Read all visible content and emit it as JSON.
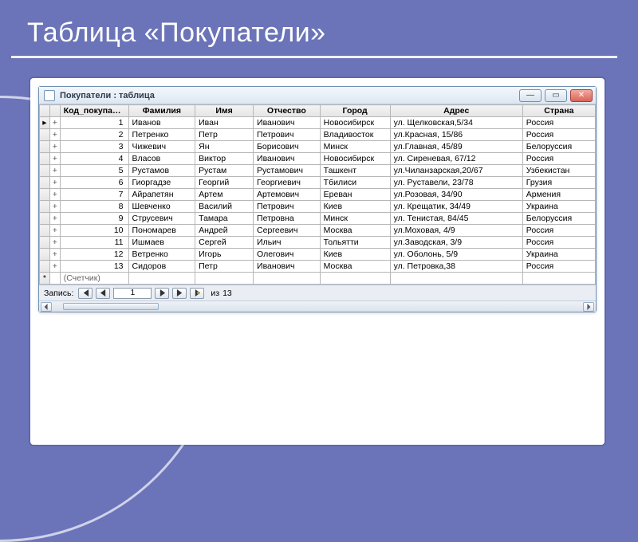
{
  "slide": {
    "title": "Таблица «Покупатели»"
  },
  "window": {
    "title": "Покупатели : таблица",
    "min": "—",
    "restore": "▭",
    "close": "✕"
  },
  "columns": {
    "id": "Код_покупател",
    "surname": "Фамилия",
    "name": "Имя",
    "patronymic": "Отчество",
    "city": "Город",
    "address": "Адрес",
    "country": "Страна"
  },
  "rows": [
    {
      "id": "1",
      "surname": "Иванов",
      "name": "Иван",
      "patronymic": "Иванович",
      "city": "Новосибирск",
      "address": "ул. Щелковская,5/34",
      "country": "Россия"
    },
    {
      "id": "2",
      "surname": "Петренко",
      "name": "Петр",
      "patronymic": "Петрович",
      "city": "Владивосток",
      "address": "ул.Красная, 15/86",
      "country": "Россия"
    },
    {
      "id": "3",
      "surname": "Чижевич",
      "name": "Ян",
      "patronymic": "Борисович",
      "city": "Минск",
      "address": "ул.Главная, 45/89",
      "country": "Белоруссия"
    },
    {
      "id": "4",
      "surname": "Власов",
      "name": "Виктор",
      "patronymic": "Иванович",
      "city": "Новосибирск",
      "address": "ул. Сиреневая, 67/12",
      "country": "Россия"
    },
    {
      "id": "5",
      "surname": "Рустамов",
      "name": "Рустам",
      "patronymic": "Рустамович",
      "city": "Ташкент",
      "address": "ул.Чиланзарская,20/67",
      "country": "Узбекистан"
    },
    {
      "id": "6",
      "surname": "Гиоргадзе",
      "name": "Георгий",
      "patronymic": "Георгиевич",
      "city": "Тбилиси",
      "address": "ул. Руставели, 23/78",
      "country": "Грузия"
    },
    {
      "id": "7",
      "surname": "Айрапетян",
      "name": "Артем",
      "patronymic": "Артемович",
      "city": "Ереван",
      "address": "ул.Розовая, 34/90",
      "country": "Армения"
    },
    {
      "id": "8",
      "surname": "Шевченко",
      "name": "Василий",
      "patronymic": "Петрович",
      "city": "Киев",
      "address": "ул. Крещатик, 34/49",
      "country": "Украина"
    },
    {
      "id": "9",
      "surname": "Струсевич",
      "name": "Тамара",
      "patronymic": "Петровна",
      "city": "Минск",
      "address": "ул. Тенистая, 84/45",
      "country": "Белоруссия"
    },
    {
      "id": "10",
      "surname": "Пономарев",
      "name": "Андрей",
      "patronymic": "Сергеевич",
      "city": "Москва",
      "address": "ул.Моховая, 4/9",
      "country": "Россия"
    },
    {
      "id": "11",
      "surname": "Ишмаев",
      "name": "Сергей",
      "patronymic": "Ильич",
      "city": "Тольятти",
      "address": "ул.Заводская, 3/9",
      "country": "Россия"
    },
    {
      "id": "12",
      "surname": "Ветренко",
      "name": "Игорь",
      "patronymic": "Олегович",
      "city": "Киев",
      "address": "ул. Оболонь, 5/9",
      "country": "Украина"
    },
    {
      "id": "13",
      "surname": "Сидоров",
      "name": "Петр",
      "patronymic": "Иванович",
      "city": "Москва",
      "address": "ул. Петровка,38",
      "country": "Россия"
    }
  ],
  "newrow_placeholder": "(Счетчик)",
  "nav": {
    "label": "Запись:",
    "current": "1",
    "of_label": "из",
    "total": "13"
  },
  "glyphs": {
    "expand": "+",
    "newrow": "*",
    "current_row": "▸"
  }
}
